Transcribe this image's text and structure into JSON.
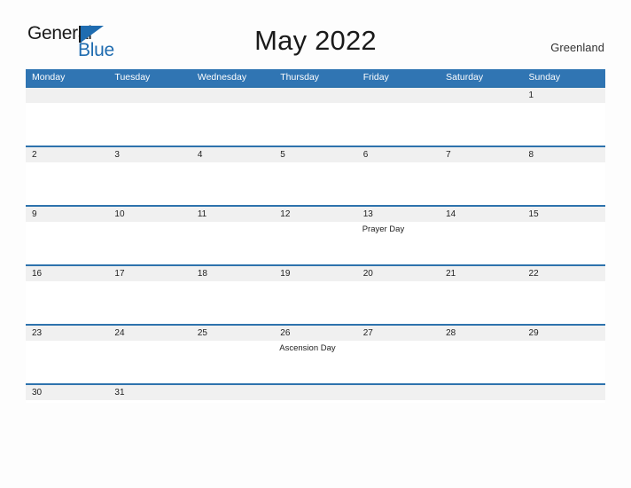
{
  "logo": {
    "word_one": "General",
    "word_two": "Blue",
    "triangle_color": "#1f6cb0"
  },
  "header": {
    "title": "May 2022",
    "country": "Greenland",
    "header_color": "#3075b3",
    "row_line_color": "#2e73ad",
    "date_band_color": "#f0f0f0"
  },
  "weekdays": [
    "Monday",
    "Tuesday",
    "Wednesday",
    "Thursday",
    "Friday",
    "Saturday",
    "Sunday"
  ],
  "weeks": [
    {
      "days": [
        {
          "date": "",
          "event": ""
        },
        {
          "date": "",
          "event": ""
        },
        {
          "date": "",
          "event": ""
        },
        {
          "date": "",
          "event": ""
        },
        {
          "date": "",
          "event": ""
        },
        {
          "date": "",
          "event": ""
        },
        {
          "date": "1",
          "event": ""
        }
      ]
    },
    {
      "days": [
        {
          "date": "2",
          "event": ""
        },
        {
          "date": "3",
          "event": ""
        },
        {
          "date": "4",
          "event": ""
        },
        {
          "date": "5",
          "event": ""
        },
        {
          "date": "6",
          "event": ""
        },
        {
          "date": "7",
          "event": ""
        },
        {
          "date": "8",
          "event": ""
        }
      ]
    },
    {
      "days": [
        {
          "date": "9",
          "event": ""
        },
        {
          "date": "10",
          "event": ""
        },
        {
          "date": "11",
          "event": ""
        },
        {
          "date": "12",
          "event": ""
        },
        {
          "date": "13",
          "event": "Prayer Day"
        },
        {
          "date": "14",
          "event": ""
        },
        {
          "date": "15",
          "event": ""
        }
      ]
    },
    {
      "days": [
        {
          "date": "16",
          "event": ""
        },
        {
          "date": "17",
          "event": ""
        },
        {
          "date": "18",
          "event": ""
        },
        {
          "date": "19",
          "event": ""
        },
        {
          "date": "20",
          "event": ""
        },
        {
          "date": "21",
          "event": ""
        },
        {
          "date": "22",
          "event": ""
        }
      ]
    },
    {
      "days": [
        {
          "date": "23",
          "event": ""
        },
        {
          "date": "24",
          "event": ""
        },
        {
          "date": "25",
          "event": ""
        },
        {
          "date": "26",
          "event": "Ascension Day"
        },
        {
          "date": "27",
          "event": ""
        },
        {
          "date": "28",
          "event": ""
        },
        {
          "date": "29",
          "event": ""
        }
      ]
    },
    {
      "days": [
        {
          "date": "30",
          "event": ""
        },
        {
          "date": "31",
          "event": ""
        },
        {
          "date": "",
          "event": ""
        },
        {
          "date": "",
          "event": ""
        },
        {
          "date": "",
          "event": ""
        },
        {
          "date": "",
          "event": ""
        },
        {
          "date": "",
          "event": ""
        }
      ]
    }
  ]
}
